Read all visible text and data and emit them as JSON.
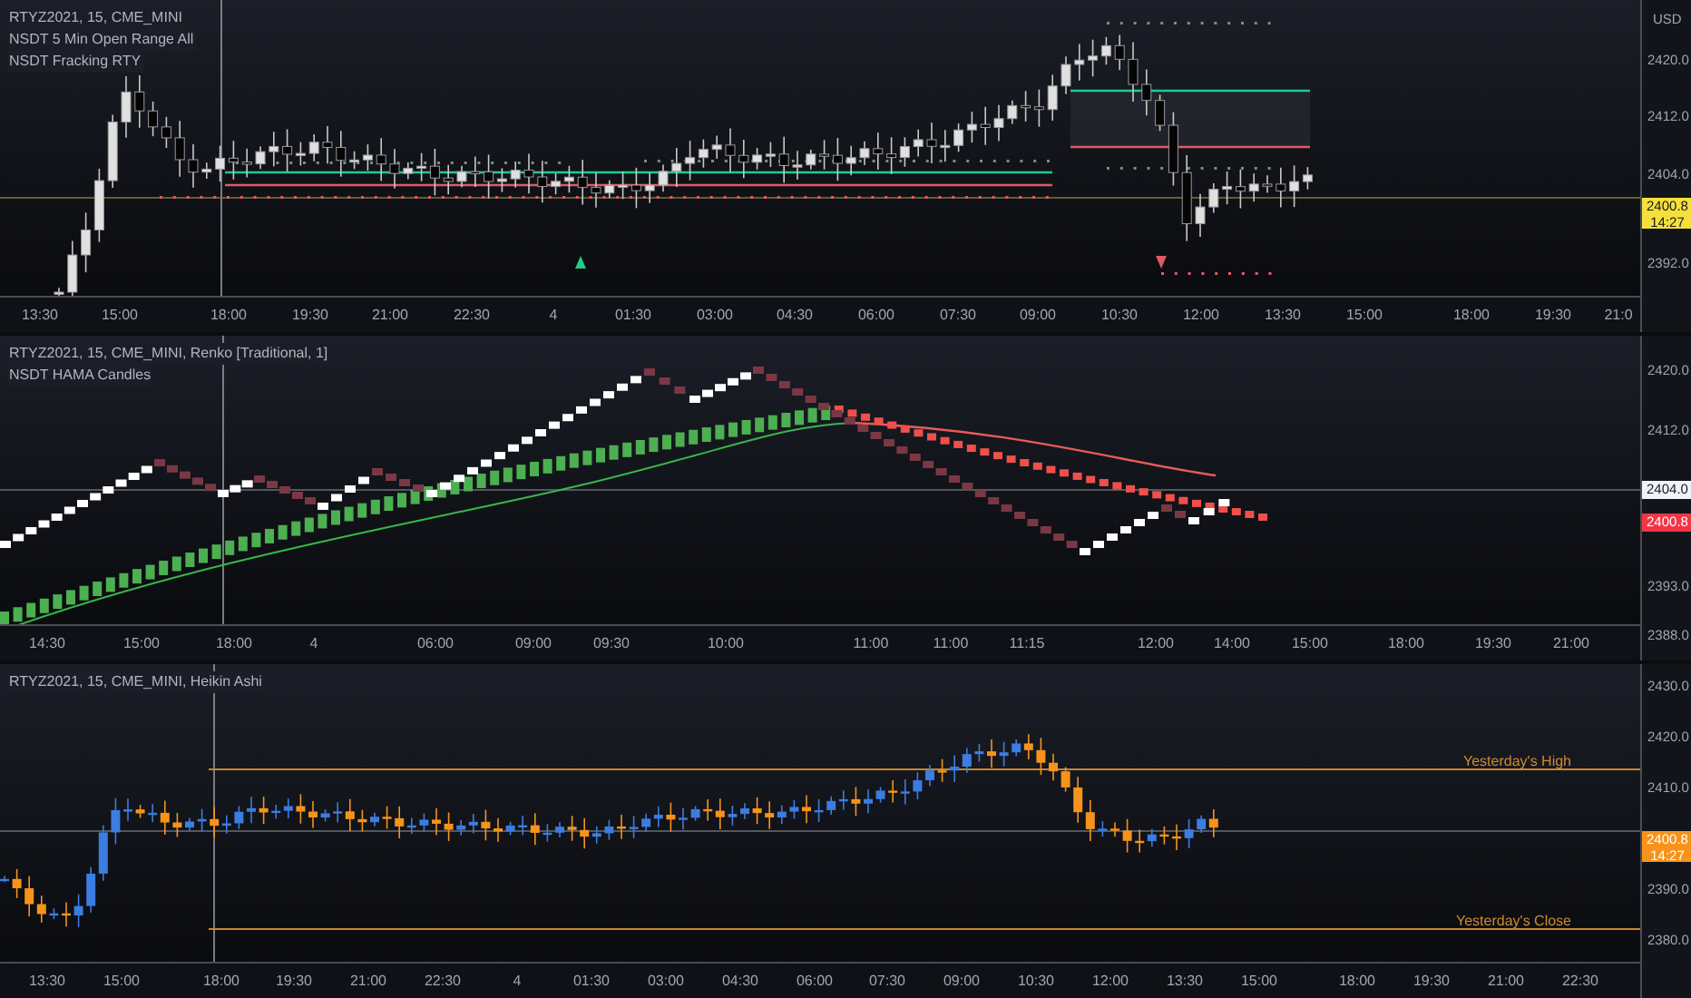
{
  "panes": [
    {
      "kind": "candles",
      "legend": [
        "RTYZ2021, 15, CME_MINI",
        "NSDT 5 Min Open Range All",
        "NSDT Fracking RTY"
      ],
      "currency": "USD",
      "price_ticks": [
        "2420.0",
        "2412.0",
        "2404.0",
        "2392.0"
      ],
      "price_tag": {
        "price": "2400.8",
        "countdown": "14:27",
        "color": "#f5e03b"
      },
      "time_ticks": [
        "13:30",
        "15:00",
        "18:00",
        "19:30",
        "21:00",
        "22:30",
        "4",
        "01:30",
        "03:00",
        "04:30",
        "06:00",
        "07:30",
        "09:00",
        "10:30",
        "12:00",
        "13:30",
        "15:00",
        "18:00",
        "19:30",
        "21:0"
      ]
    },
    {
      "kind": "renko",
      "legend": [
        "RTYZ2021, 15, CME_MINI, Renko [Traditional, 1]",
        "NSDT HAMA Candles"
      ],
      "price_ticks": [
        "2420.0",
        "2412.0",
        "2393.0",
        "2388.0"
      ],
      "crosshair_price": "2404.0",
      "price_tag": {
        "price": "2400.8",
        "color": "#f23645"
      },
      "time_ticks": [
        "14:30",
        "15:00",
        "18:00",
        "4",
        "06:00",
        "09:00",
        "09:30",
        "10:00",
        "11:00",
        "11:00",
        "11:15",
        "12:00",
        "14:00",
        "15:00",
        "18:00",
        "19:30",
        "21:00"
      ]
    },
    {
      "kind": "heikin",
      "legend": [
        "RTYZ2021, 15, CME_MINI, Heikin Ashi"
      ],
      "price_ticks": [
        "2430.0",
        "2420.0",
        "2410.0",
        "2390.0",
        "2380.0"
      ],
      "price_tag": {
        "price": "2400.8",
        "countdown": "14:27",
        "color": "#f7931a"
      },
      "level_labels": [
        "Yesterday's High",
        "Yesterday's Close"
      ],
      "time_ticks": [
        "13:30",
        "15:00",
        "18:00",
        "19:30",
        "21:00",
        "22:30",
        "4",
        "01:30",
        "03:00",
        "04:30",
        "06:00",
        "07:30",
        "09:00",
        "10:30",
        "12:00",
        "13:30",
        "15:00",
        "18:00",
        "19:30",
        "21:00",
        "22:30"
      ]
    }
  ]
}
